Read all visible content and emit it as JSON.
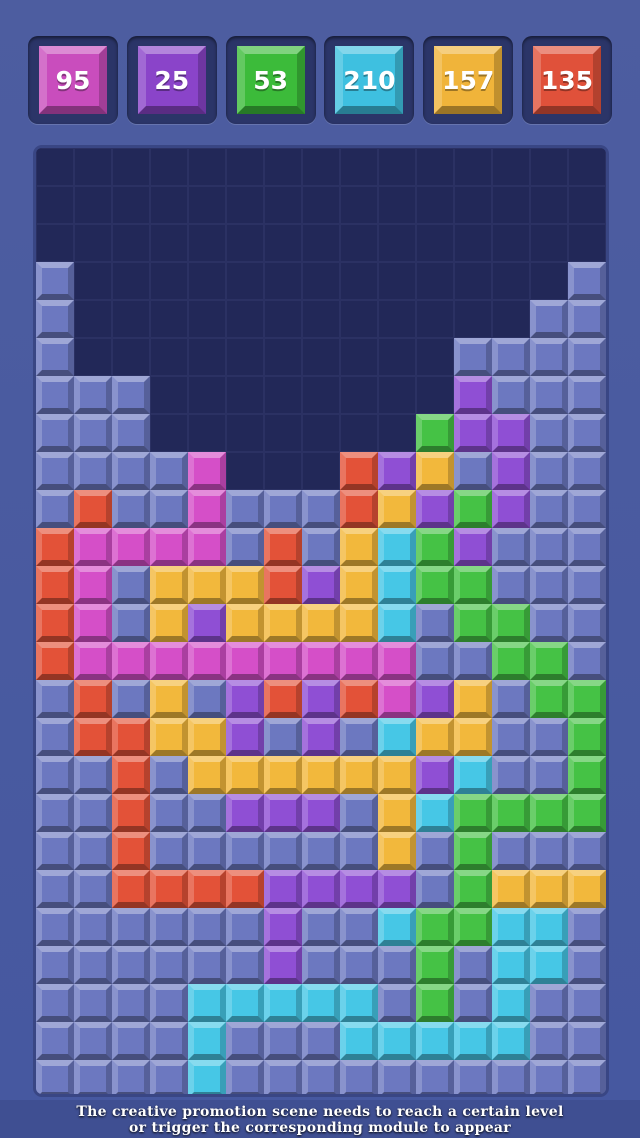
{
  "scores": [
    {
      "value": "95",
      "color": "#c94dbd"
    },
    {
      "value": "25",
      "color": "#8a44c9"
    },
    {
      "value": "53",
      "color": "#3cbb3a"
    },
    {
      "value": "210",
      "color": "#3ec0e0"
    },
    {
      "value": "157",
      "color": "#f0b43a"
    },
    {
      "value": "135",
      "color": "#e0513a"
    }
  ],
  "palette": {
    "G": "#6c78c0",
    "M": "#d54fc8",
    "P": "#8f4fd4",
    "N": "#45c245",
    "C": "#46c7e6",
    "Y": "#f2b83c",
    "R": "#e35238"
  },
  "board": {
    "columns": 15,
    "rows": [
      "...............",
      "...............",
      "...............",
      "G.............G",
      "G............GG",
      "G..........GGGG",
      "GGG........PGGG",
      "GGG.......NPPGG",
      "GGGGM...RPYGPGG",
      "GRGGMGGGRYPNPGG",
      "RMMMMGRGYCNPGGG",
      "RMGYYYRPYCNNGGG",
      "RMGYPYYYYCGNNGG",
      "RMMMMMMMMMGGNNG",
      "GRGYGPRPRMPYGNN",
      "GRRYYPGPGCYYGGN",
      "GGRGYYYYYYPCGGN",
      "GGRGGPPPGYCNNNN",
      "GGRGGGGGGYGNGGG",
      "GGRRRRPPPPGNYYY",
      "GGGGGGPGGCNNCCG",
      "GGGGGGPGGGNGCCG",
      "GGGGCCCCCGNGCGG",
      "GGGGCGGGCCCCCGG",
      "GGGGCGGGGGGGGGG"
    ]
  },
  "caption": {
    "line1": "The creative promotion scene needs to reach a certain level",
    "line2": "or trigger the corresponding module to appear"
  }
}
